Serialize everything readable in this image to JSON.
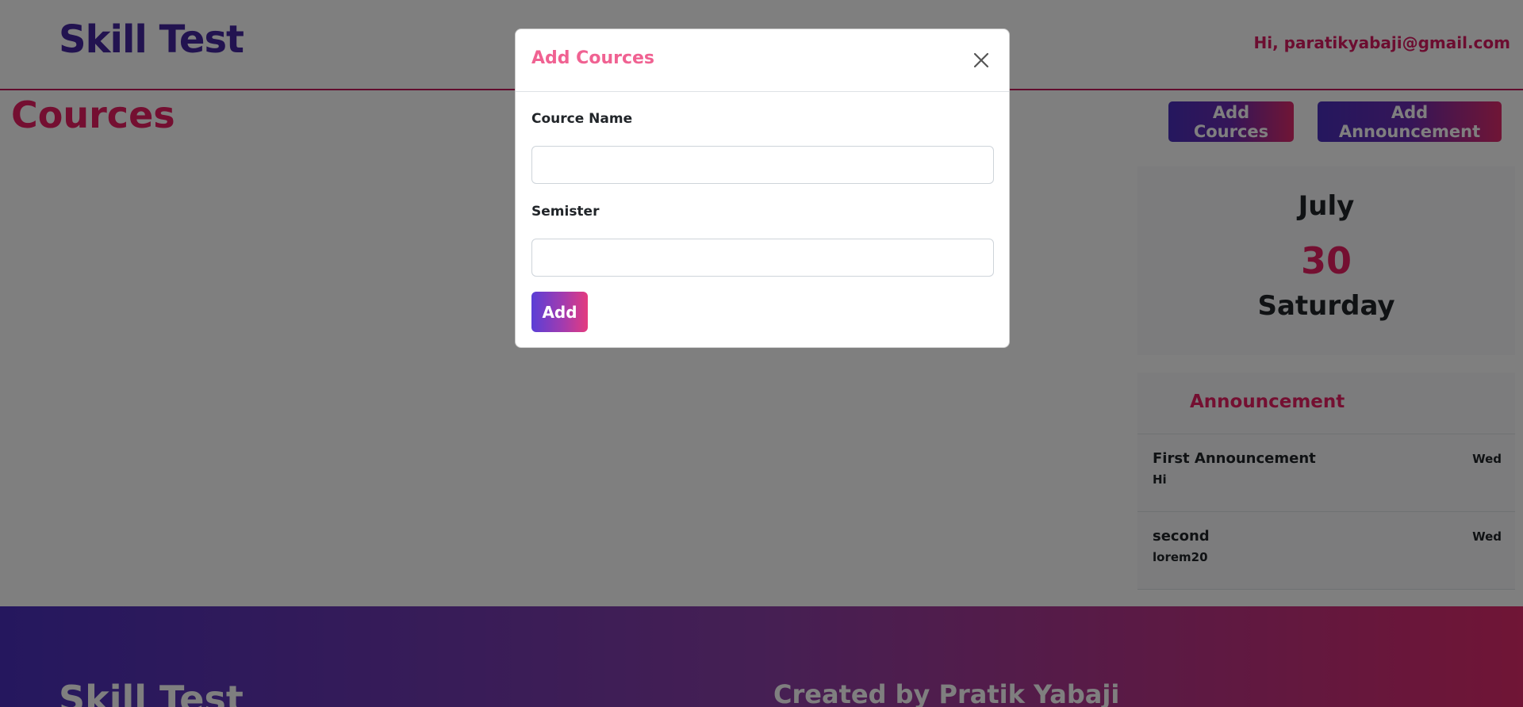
{
  "navbar": {
    "brand": "Skill Test",
    "greeting": "Hi, paratikyabaji@gmail.com"
  },
  "page": {
    "title": "Cources",
    "add_cources_label": "Add Cources",
    "add_announcement_label": "Add Announcement"
  },
  "date_card": {
    "month": "July",
    "day": "30",
    "weekday": "Saturday"
  },
  "announcements": {
    "heading": "Announcement",
    "items": [
      {
        "title": "First Announcement",
        "body": "Hi",
        "day": "Wed"
      },
      {
        "title": "second",
        "body": "lorem20",
        "day": "Wed"
      }
    ]
  },
  "footer": {
    "brand": "Skill Test",
    "credit": "Created by Pratik Yabaji"
  },
  "modal": {
    "title": "Add Cources",
    "close_icon": "close-icon",
    "course_name_label": "Cource Name",
    "course_name_value": "",
    "semester_label": "Semister",
    "semester_value": "",
    "submit_label": "Add"
  },
  "colors": {
    "brand": "#4527a0",
    "accent": "#e91e63",
    "gradient_start": "#4a2fbd",
    "gradient_end": "#e02a6c"
  }
}
